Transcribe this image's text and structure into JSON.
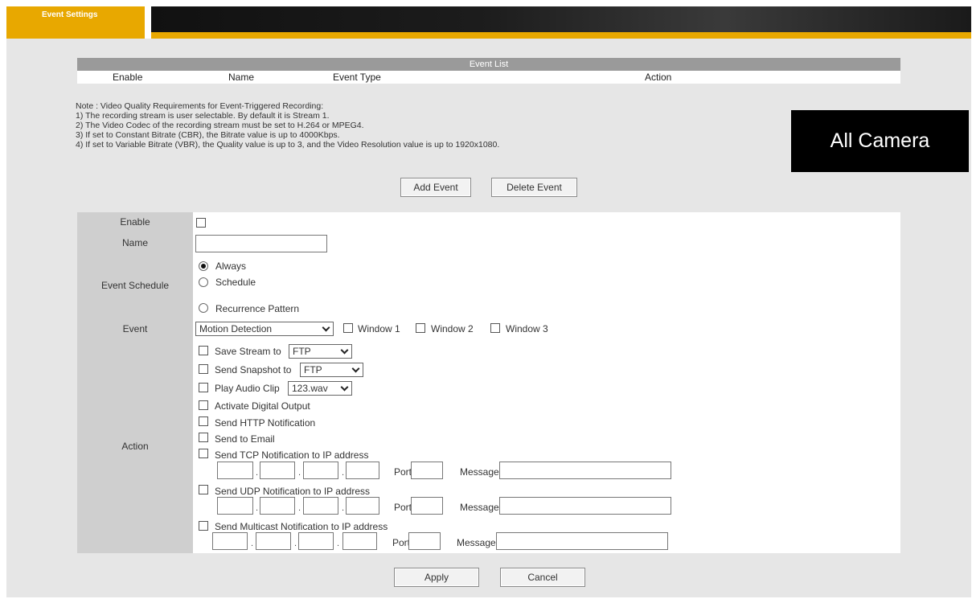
{
  "header": {
    "tab_label": "Event Settings"
  },
  "event_list": {
    "title": "Event List",
    "columns": [
      "Enable",
      "Name",
      "Event Type",
      "Action"
    ]
  },
  "note": {
    "lines": [
      "Note : Video Quality Requirements for Event-Triggered Recording:",
      "1) The recording stream is user selectable. By default it is Stream 1.",
      "2) The Video Codec of the recording stream must be set to H.264 or MPEG4.",
      "3) If set to Constant Bitrate (CBR), the Bitrate value is up to 4000Kbps.",
      "4) If set to Variable Bitrate (VBR), the Quality value is up to 3, and the Video Resolution value is up to 1920x1080."
    ]
  },
  "overlay_label": "All Camera",
  "buttons": {
    "add_event": "Add Event",
    "delete_event": "Delete Event",
    "apply": "Apply",
    "cancel": "Cancel"
  },
  "form": {
    "labels": {
      "enable": "Enable",
      "name": "Name",
      "event_schedule": "Event Schedule",
      "event": "Event",
      "action": "Action"
    },
    "enable_checked": false,
    "name_value": "",
    "schedule": {
      "always": "Always",
      "schedule": "Schedule",
      "recurrence": "Recurrence Pattern",
      "selected": "Always"
    },
    "event": {
      "type_selected": "Motion Detection",
      "window1": "Window 1",
      "window2": "Window 2",
      "window3": "Window 3"
    },
    "actions": {
      "save_stream": "Save Stream to",
      "save_stream_target": "FTP",
      "send_snapshot": "Send Snapshot to",
      "send_snapshot_target": "FTP",
      "play_audio": "Play Audio Clip",
      "play_audio_file": "123.wav",
      "digital_output": "Activate Digital Output",
      "http_notification": "Send HTTP Notification",
      "email": "Send to Email",
      "tcp": "Send TCP Notification to IP address",
      "udp": "Send UDP Notification to IP address",
      "multicast": "Send Multicast Notification to IP address",
      "port_label": "Port",
      "message_label": "Message",
      "ip_separator": "."
    }
  }
}
